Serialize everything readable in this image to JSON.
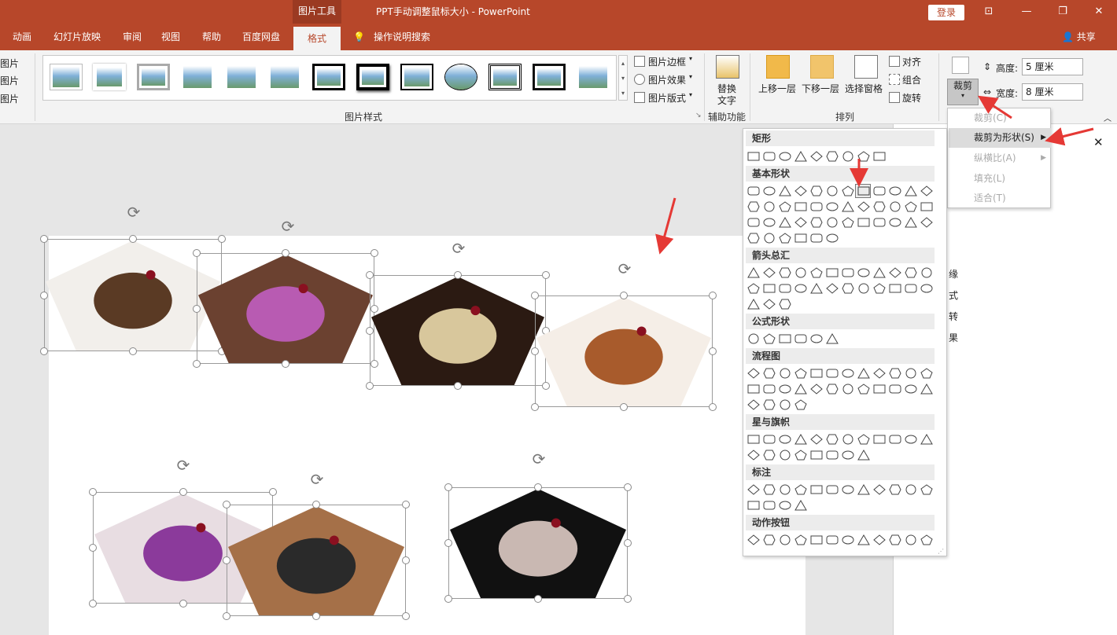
{
  "titlebar": {
    "context_tool": "图片工具",
    "document_title": "PPT手动调整鼠标大小 - PowerPoint",
    "login_label": "登录"
  },
  "tabs": {
    "items": [
      "动画",
      "幻灯片放映",
      "审阅",
      "视图",
      "帮助",
      "百度网盘"
    ],
    "active": "格式",
    "tell_me": "操作说明搜索",
    "share": "共享"
  },
  "ribbon": {
    "left_partial": [
      "图片",
      "图片",
      "图片"
    ],
    "styles_group_label": "图片样式",
    "border_label": "图片边框",
    "effects_label": "图片效果",
    "layout_label": "图片版式",
    "alt_text_label_1": "替换",
    "alt_text_label_2": "文字",
    "accessibility_group_label": "辅助功能",
    "bring_forward": "上移一层",
    "send_backward": "下移一层",
    "selection_pane": "选择窗格",
    "align": "对齐",
    "group": "组合",
    "rotate": "旋转",
    "arrange_group_label": "排列",
    "crop": "裁剪",
    "height_label": "高度:",
    "height_value": "5 厘米",
    "width_label": "宽度:",
    "width_value": "8 厘米"
  },
  "crop_menu": {
    "items": [
      {
        "label": "裁剪(C)",
        "enabled": false
      },
      {
        "label": "裁剪为形状(S)",
        "enabled": true,
        "highlighted": true
      },
      {
        "label": "纵横比(A)",
        "enabled": false
      },
      {
        "label": "填充(L)",
        "enabled": false
      },
      {
        "label": "适合(T)",
        "enabled": false
      }
    ]
  },
  "shape_gallery": {
    "categories": [
      "矩形",
      "基本形状",
      "箭头总汇",
      "公式形状",
      "流程图",
      "星与旗帜",
      "标注",
      "动作按钮"
    ],
    "numbered_shapes": [
      "7",
      "8",
      "10",
      "12"
    ]
  },
  "right_pane": {
    "partial_labels": [
      "缘",
      "式",
      "转",
      "果"
    ]
  },
  "slide": {
    "pictures": [
      {
        "name": "ice-cream-chocolate"
      },
      {
        "name": "ice-cream-cones-cherries"
      },
      {
        "name": "ice-cream-sundae-dark"
      },
      {
        "name": "ice-cream-bowl-caramel"
      },
      {
        "name": "ice-cream-purple-blueberries"
      },
      {
        "name": "ice-cream-fruit-bowl"
      },
      {
        "name": "ice-cream-glass-cherries"
      }
    ]
  },
  "colors": {
    "accent": "#b7472a",
    "ribbon_bg": "#f3f3f3",
    "arrow": "#e53935"
  }
}
